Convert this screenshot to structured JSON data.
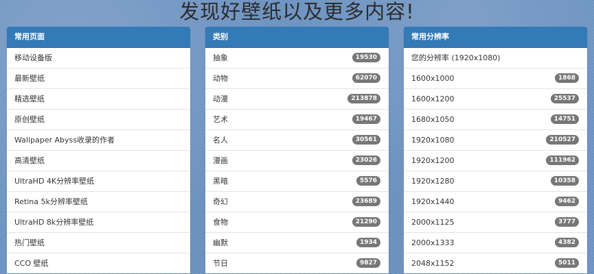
{
  "page_title": "发现好壁纸以及更多内容!",
  "panels": [
    {
      "header": "常用页面",
      "items": [
        {
          "label": "移动设备版"
        },
        {
          "label": "最新壁纸"
        },
        {
          "label": "精选壁纸"
        },
        {
          "label": "原创壁纸"
        },
        {
          "label": "Wallpaper Abyss收录的作者"
        },
        {
          "label": "高清壁纸"
        },
        {
          "label": "UltraHD 4K分辨率壁纸"
        },
        {
          "label": "Retina 5k分辨率壁纸"
        },
        {
          "label": "UltraHD 8k分辨率壁纸"
        },
        {
          "label": "热门壁纸"
        },
        {
          "label": "CCO 壁纸"
        }
      ]
    },
    {
      "header": "类别",
      "items": [
        {
          "label": "抽象",
          "count": "19530"
        },
        {
          "label": "动物",
          "count": "62070"
        },
        {
          "label": "动漫",
          "count": "213878"
        },
        {
          "label": "艺术",
          "count": "19467"
        },
        {
          "label": "名人",
          "count": "30561"
        },
        {
          "label": "漫画",
          "count": "23026"
        },
        {
          "label": "黑暗",
          "count": "5576"
        },
        {
          "label": "奇幻",
          "count": "23689"
        },
        {
          "label": "食物",
          "count": "21290"
        },
        {
          "label": "幽默",
          "count": "1934"
        },
        {
          "label": "节日",
          "count": "9827"
        }
      ]
    },
    {
      "header": "常用分辨率",
      "items": [
        {
          "label": "您的分辨率 (1920x1080)"
        },
        {
          "label": "1600x1000",
          "count": "1868"
        },
        {
          "label": "1600x1200",
          "count": "25537"
        },
        {
          "label": "1680x1050",
          "count": "14751"
        },
        {
          "label": "1920x1080",
          "count": "210527"
        },
        {
          "label": "1920x1200",
          "count": "111962"
        },
        {
          "label": "1920x1280",
          "count": "10358"
        },
        {
          "label": "1920x1440",
          "count": "9462"
        },
        {
          "label": "2000x1125",
          "count": "3777"
        },
        {
          "label": "2000x1333",
          "count": "4382"
        },
        {
          "label": "2048x1152",
          "count": "5011"
        }
      ]
    }
  ]
}
